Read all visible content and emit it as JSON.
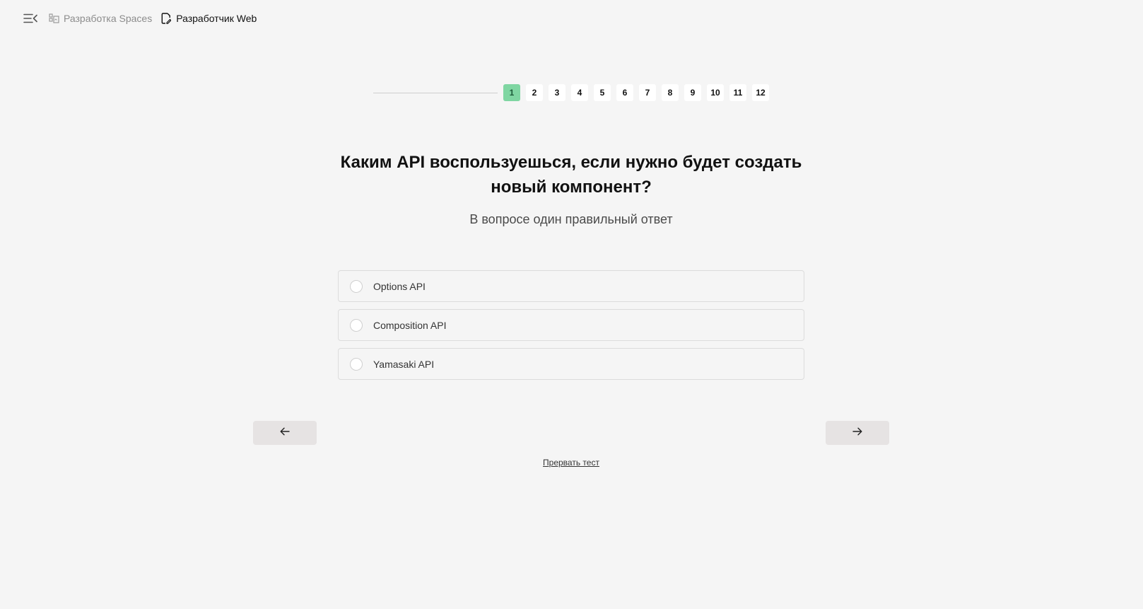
{
  "breadcrumb": {
    "parent": "Разработка Spaces",
    "current": "Разработчик Web"
  },
  "stepper": {
    "steps": [
      "1",
      "2",
      "3",
      "4",
      "5",
      "6",
      "7",
      "8",
      "9",
      "10",
      "11",
      "12"
    ],
    "active_index": 0
  },
  "question": {
    "title": "Каким API воспользуешься, если нужно будет создать новый компонент?",
    "hint": "В вопросе один правильный ответ"
  },
  "options": [
    {
      "label": "Options API"
    },
    {
      "label": "Composition API"
    },
    {
      "label": "Yamasaki API"
    }
  ],
  "navigation": {
    "prev_icon": "arrow-left-icon",
    "next_icon": "arrow-right-icon"
  },
  "abort_label": "Прервать тест",
  "colors": {
    "background": "#f5f5f5",
    "active_step": "#7fd6a2",
    "nav_button": "#e6e3e3"
  }
}
